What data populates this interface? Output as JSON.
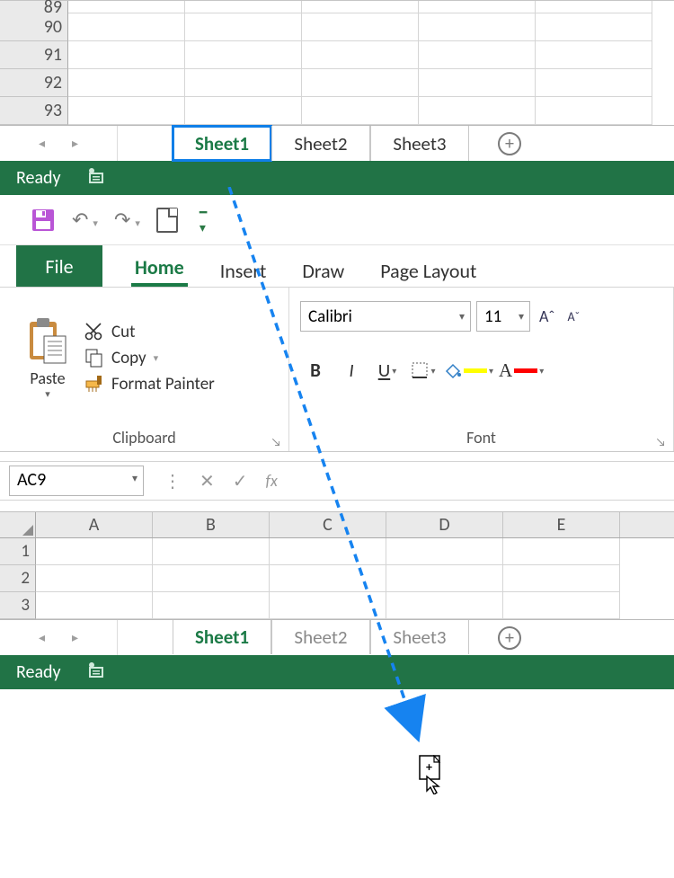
{
  "workbook1": {
    "rows": [
      "89",
      "90",
      "91",
      "92",
      "93"
    ],
    "tabs": [
      "Sheet1",
      "Sheet2",
      "Sheet3"
    ],
    "active_tab": 0
  },
  "status": {
    "text": "Ready"
  },
  "ribbon": {
    "tabs": {
      "file": "File",
      "home": "Home",
      "insert": "Insert",
      "draw": "Draw",
      "page_layout": "Page Layout"
    },
    "active_tab": "home"
  },
  "clipboard": {
    "paste": "Paste",
    "cut": "Cut",
    "copy": "Copy",
    "format_painter": "Format Painter",
    "group_label": "Clipboard"
  },
  "font": {
    "name": "Calibri",
    "size": "11",
    "group_label": "Font",
    "fill_color": "#ffff00",
    "font_color": "#ff0000"
  },
  "namebox": {
    "value": "AC9"
  },
  "fx": {
    "label": "fx"
  },
  "workbook2": {
    "columns": [
      "A",
      "B",
      "C",
      "D",
      "E"
    ],
    "rows": [
      "1",
      "2",
      "3"
    ],
    "tabs": [
      "Sheet1",
      "Sheet2",
      "Sheet3"
    ],
    "active_tab": 0
  }
}
